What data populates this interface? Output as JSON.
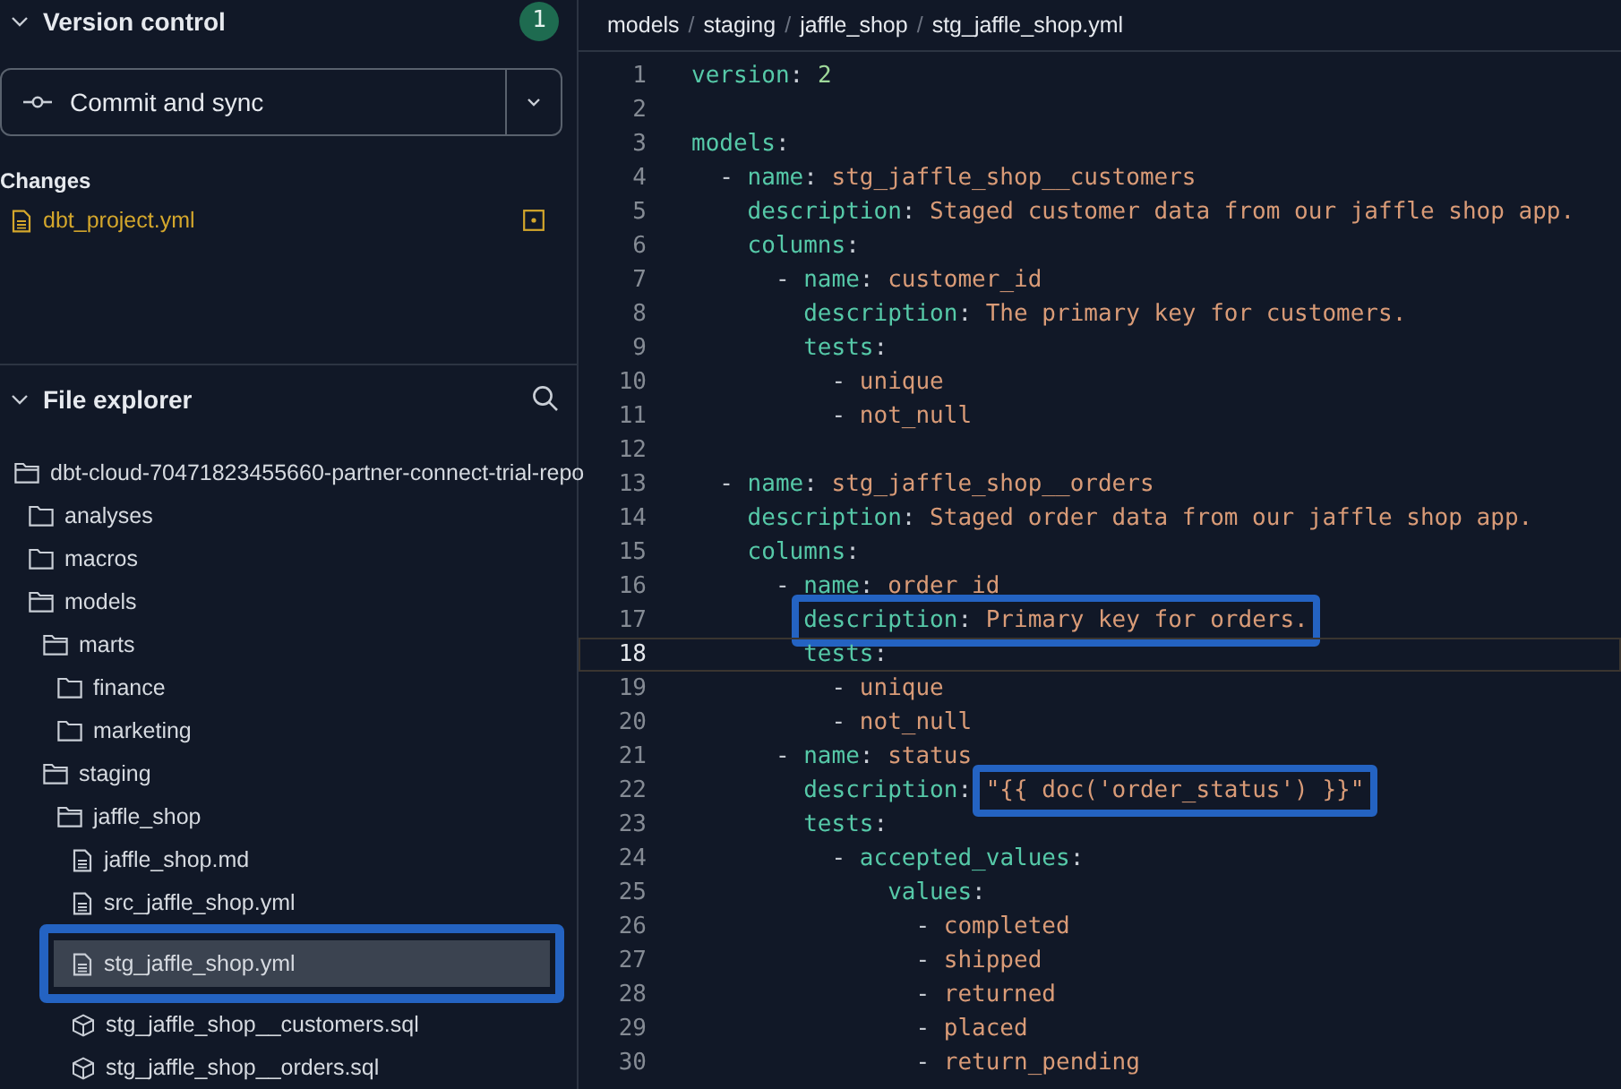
{
  "version_control": {
    "title": "Version control",
    "expanded": true,
    "badge": "1",
    "commit_button": "Commit and sync",
    "changes_title": "Changes",
    "changes": [
      {
        "name": "dbt_project.yml",
        "modified": true
      }
    ]
  },
  "file_explorer": {
    "title": "File explorer",
    "expanded": true,
    "tree": [
      {
        "name": "dbt-cloud-70471823455660-partner-connect-trial-repo",
        "kind": "folder",
        "expanded": true,
        "selected": false,
        "annotated": false,
        "children": [
          {
            "name": "analyses",
            "kind": "folder",
            "expanded": false,
            "selected": false,
            "annotated": false
          },
          {
            "name": "macros",
            "kind": "folder",
            "expanded": false,
            "selected": false,
            "annotated": false
          },
          {
            "name": "models",
            "kind": "folder",
            "expanded": true,
            "selected": false,
            "annotated": false,
            "children": [
              {
                "name": "marts",
                "kind": "folder",
                "expanded": true,
                "selected": false,
                "annotated": false,
                "children": [
                  {
                    "name": "finance",
                    "kind": "folder",
                    "expanded": false,
                    "selected": false,
                    "annotated": false
                  },
                  {
                    "name": "marketing",
                    "kind": "folder",
                    "expanded": false,
                    "selected": false,
                    "annotated": false
                  }
                ]
              },
              {
                "name": "staging",
                "kind": "folder",
                "expanded": true,
                "selected": false,
                "annotated": false,
                "children": [
                  {
                    "name": "jaffle_shop",
                    "kind": "folder",
                    "expanded": true,
                    "selected": false,
                    "annotated": false,
                    "children": [
                      {
                        "name": "jaffle_shop.md",
                        "kind": "file",
                        "selected": false,
                        "annotated": false
                      },
                      {
                        "name": "src_jaffle_shop.yml",
                        "kind": "file",
                        "selected": false,
                        "annotated": false
                      },
                      {
                        "name": "stg_jaffle_shop.yml",
                        "kind": "file",
                        "selected": true,
                        "annotated": true
                      },
                      {
                        "name": "stg_jaffle_shop__customers.sql",
                        "kind": "model",
                        "selected": false,
                        "annotated": false
                      },
                      {
                        "name": "stg_jaffle_shop__orders.sql",
                        "kind": "model",
                        "selected": false,
                        "annotated": false
                      }
                    ]
                  }
                ]
              }
            ]
          }
        ]
      }
    ]
  },
  "editor": {
    "breadcrumb": {
      "items": [
        "models",
        "staging",
        "jaffle_shop",
        "stg_jaffle_shop.yml"
      ],
      "separators": [
        "/",
        "/",
        "/"
      ]
    },
    "lines": [
      {
        "number": "1",
        "current": false,
        "segments": [
          {
            "boxed": false,
            "tokens": [
              {
                "kind": "key",
                "text": "version"
              },
              {
                "kind": "plain",
                "text": ": "
              },
              {
                "kind": "number",
                "text": "2"
              }
            ]
          }
        ]
      },
      {
        "number": "2",
        "current": false
      },
      {
        "number": "3",
        "current": false,
        "segments": [
          {
            "boxed": false,
            "tokens": [
              {
                "kind": "key",
                "text": "models"
              },
              {
                "kind": "plain",
                "text": ":"
              }
            ]
          }
        ],
        "children": [
          {
            "number": "4",
            "current": false,
            "segments": [
              {
                "boxed": false,
                "tokens": [
                  {
                    "kind": "dash",
                    "text": "- "
                  },
                  {
                    "kind": "key",
                    "text": "name"
                  },
                  {
                    "kind": "plain",
                    "text": ": "
                  },
                  {
                    "kind": "value",
                    "text": "stg_jaffle_shop__customers"
                  }
                ]
              }
            ],
            "children": [
              {
                "number": "5",
                "current": false,
                "segments": [
                  {
                    "boxed": false,
                    "tokens": [
                      {
                        "kind": "key",
                        "text": "description"
                      },
                      {
                        "kind": "plain",
                        "text": ": "
                      },
                      {
                        "kind": "value",
                        "text": "Staged customer data from our jaffle shop app."
                      }
                    ]
                  }
                ]
              },
              {
                "number": "6",
                "current": false,
                "segments": [
                  {
                    "boxed": false,
                    "tokens": [
                      {
                        "kind": "key",
                        "text": "columns"
                      },
                      {
                        "kind": "plain",
                        "text": ":"
                      }
                    ]
                  }
                ],
                "children": [
                  {
                    "number": "7",
                    "current": false,
                    "segments": [
                      {
                        "boxed": false,
                        "tokens": [
                          {
                            "kind": "dash",
                            "text": "- "
                          },
                          {
                            "kind": "key",
                            "text": "name"
                          },
                          {
                            "kind": "plain",
                            "text": ": "
                          },
                          {
                            "kind": "value",
                            "text": "customer_id"
                          }
                        ]
                      }
                    ],
                    "children": [
                      {
                        "number": "8",
                        "current": false,
                        "segments": [
                          {
                            "boxed": false,
                            "tokens": [
                              {
                                "kind": "key",
                                "text": "description"
                              },
                              {
                                "kind": "plain",
                                "text": ": "
                              },
                              {
                                "kind": "value",
                                "text": "The primary key for customers."
                              }
                            ]
                          }
                        ]
                      },
                      {
                        "number": "9",
                        "current": false,
                        "segments": [
                          {
                            "boxed": false,
                            "tokens": [
                              {
                                "kind": "key",
                                "text": "tests"
                              },
                              {
                                "kind": "plain",
                                "text": ":"
                              }
                            ]
                          }
                        ],
                        "children": [
                          {
                            "number": "10",
                            "current": false,
                            "segments": [
                              {
                                "boxed": false,
                                "tokens": [
                                  {
                                    "kind": "dash",
                                    "text": "- "
                                  },
                                  {
                                    "kind": "value",
                                    "text": "unique"
                                  }
                                ]
                              }
                            ]
                          },
                          {
                            "number": "11",
                            "current": false,
                            "segments": [
                              {
                                "boxed": false,
                                "tokens": [
                                  {
                                    "kind": "dash",
                                    "text": "- "
                                  },
                                  {
                                    "kind": "value",
                                    "text": "not_null"
                                  }
                                ]
                              }
                            ]
                          }
                        ]
                      }
                    ]
                  }
                ]
              }
            ]
          },
          {
            "number": "12",
            "current": false
          },
          {
            "number": "13",
            "current": false,
            "segments": [
              {
                "boxed": false,
                "tokens": [
                  {
                    "kind": "dash",
                    "text": "- "
                  },
                  {
                    "kind": "key",
                    "text": "name"
                  },
                  {
                    "kind": "plain",
                    "text": ": "
                  },
                  {
                    "kind": "value",
                    "text": "stg_jaffle_shop__orders"
                  }
                ]
              }
            ],
            "children": [
              {
                "number": "14",
                "current": false,
                "segments": [
                  {
                    "boxed": false,
                    "tokens": [
                      {
                        "kind": "key",
                        "text": "description"
                      },
                      {
                        "kind": "plain",
                        "text": ": "
                      },
                      {
                        "kind": "value",
                        "text": "Staged order data from our jaffle shop app."
                      }
                    ]
                  }
                ]
              },
              {
                "number": "15",
                "current": false,
                "segments": [
                  {
                    "boxed": false,
                    "tokens": [
                      {
                        "kind": "key",
                        "text": "columns"
                      },
                      {
                        "kind": "plain",
                        "text": ":"
                      }
                    ]
                  }
                ],
                "children": [
                  {
                    "number": "16",
                    "current": false,
                    "segments": [
                      {
                        "boxed": false,
                        "tokens": [
                          {
                            "kind": "dash",
                            "text": "- "
                          },
                          {
                            "kind": "key",
                            "text": "name"
                          },
                          {
                            "kind": "plain",
                            "text": ": "
                          },
                          {
                            "kind": "value",
                            "text": "order_id"
                          }
                        ]
                      }
                    ],
                    "children": [
                      {
                        "number": "17",
                        "current": false,
                        "segments": [
                          {
                            "boxed": true,
                            "tokens": [
                              {
                                "kind": "key",
                                "text": "description"
                              },
                              {
                                "kind": "plain",
                                "text": ": "
                              },
                              {
                                "kind": "value",
                                "text": "Primary key for orders."
                              }
                            ]
                          }
                        ]
                      },
                      {
                        "number": "18",
                        "current": true,
                        "segments": [
                          {
                            "boxed": false,
                            "tokens": [
                              {
                                "kind": "key",
                                "text": "tests"
                              },
                              {
                                "kind": "plain",
                                "text": ":"
                              }
                            ]
                          }
                        ],
                        "children": [
                          {
                            "number": "19",
                            "current": false,
                            "segments": [
                              {
                                "boxed": false,
                                "tokens": [
                                  {
                                    "kind": "dash",
                                    "text": "- "
                                  },
                                  {
                                    "kind": "value",
                                    "text": "unique"
                                  }
                                ]
                              }
                            ]
                          },
                          {
                            "number": "20",
                            "current": false,
                            "segments": [
                              {
                                "boxed": false,
                                "tokens": [
                                  {
                                    "kind": "dash",
                                    "text": "- "
                                  },
                                  {
                                    "kind": "value",
                                    "text": "not_null"
                                  }
                                ]
                              }
                            ]
                          }
                        ]
                      }
                    ]
                  },
                  {
                    "number": "21",
                    "current": false,
                    "segments": [
                      {
                        "boxed": false,
                        "tokens": [
                          {
                            "kind": "dash",
                            "text": "- "
                          },
                          {
                            "kind": "key",
                            "text": "name"
                          },
                          {
                            "kind": "plain",
                            "text": ": "
                          },
                          {
                            "kind": "value",
                            "text": "status"
                          }
                        ]
                      }
                    ],
                    "children": [
                      {
                        "number": "22",
                        "current": false,
                        "segments": [
                          {
                            "boxed": false,
                            "tokens": [
                              {
                                "kind": "key",
                                "text": "description"
                              },
                              {
                                "kind": "plain",
                                "text": ": "
                              }
                            ]
                          },
                          {
                            "boxed": true,
                            "tokens": [
                              {
                                "kind": "value",
                                "text": "\"{{ doc('order_status') }}\""
                              }
                            ]
                          }
                        ]
                      },
                      {
                        "number": "23",
                        "current": false,
                        "segments": [
                          {
                            "boxed": false,
                            "tokens": [
                              {
                                "kind": "key",
                                "text": "tests"
                              },
                              {
                                "kind": "plain",
                                "text": ":"
                              }
                            ]
                          }
                        ],
                        "children": [
                          {
                            "number": "24",
                            "current": false,
                            "segments": [
                              {
                                "boxed": false,
                                "tokens": [
                                  {
                                    "kind": "dash",
                                    "text": "- "
                                  },
                                  {
                                    "kind": "key",
                                    "text": "accepted_values"
                                  },
                                  {
                                    "kind": "plain",
                                    "text": ":"
                                  }
                                ]
                              }
                            ],
                            "children": [
                              {
                                "number": "25",
                                "current": false,
                                "segments": [
                                  {
                                    "boxed": false,
                                    "tokens": [
                                      {
                                        "kind": "key",
                                        "text": "values"
                                      },
                                      {
                                        "kind": "plain",
                                        "text": ":"
                                      }
                                    ]
                                  }
                                ],
                                "children": [
                                  {
                                    "number": "26",
                                    "current": false,
                                    "segments": [
                                      {
                                        "boxed": false,
                                        "tokens": [
                                          {
                                            "kind": "dash",
                                            "text": "- "
                                          },
                                          {
                                            "kind": "value",
                                            "text": "completed"
                                          }
                                        ]
                                      }
                                    ]
                                  },
                                  {
                                    "number": "27",
                                    "current": false,
                                    "segments": [
                                      {
                                        "boxed": false,
                                        "tokens": [
                                          {
                                            "kind": "dash",
                                            "text": "- "
                                          },
                                          {
                                            "kind": "value",
                                            "text": "shipped"
                                          }
                                        ]
                                      }
                                    ]
                                  },
                                  {
                                    "number": "28",
                                    "current": false,
                                    "segments": [
                                      {
                                        "boxed": false,
                                        "tokens": [
                                          {
                                            "kind": "dash",
                                            "text": "- "
                                          },
                                          {
                                            "kind": "value",
                                            "text": "returned"
                                          }
                                        ]
                                      }
                                    ]
                                  },
                                  {
                                    "number": "29",
                                    "current": false,
                                    "segments": [
                                      {
                                        "boxed": false,
                                        "tokens": [
                                          {
                                            "kind": "dash",
                                            "text": "- "
                                          },
                                          {
                                            "kind": "value",
                                            "text": "placed"
                                          }
                                        ]
                                      }
                                    ]
                                  },
                                  {
                                    "number": "30",
                                    "current": false,
                                    "segments": [
                                      {
                                        "boxed": false,
                                        "tokens": [
                                          {
                                            "kind": "dash",
                                            "text": "- "
                                          },
                                          {
                                            "kind": "value",
                                            "text": "return_pending"
                                          }
                                        ]
                                      }
                                    ]
                                  }
                                ]
                              }
                            ]
                          }
                        ]
                      }
                    ]
                  }
                ]
              }
            ]
          }
        ]
      }
    ]
  }
}
